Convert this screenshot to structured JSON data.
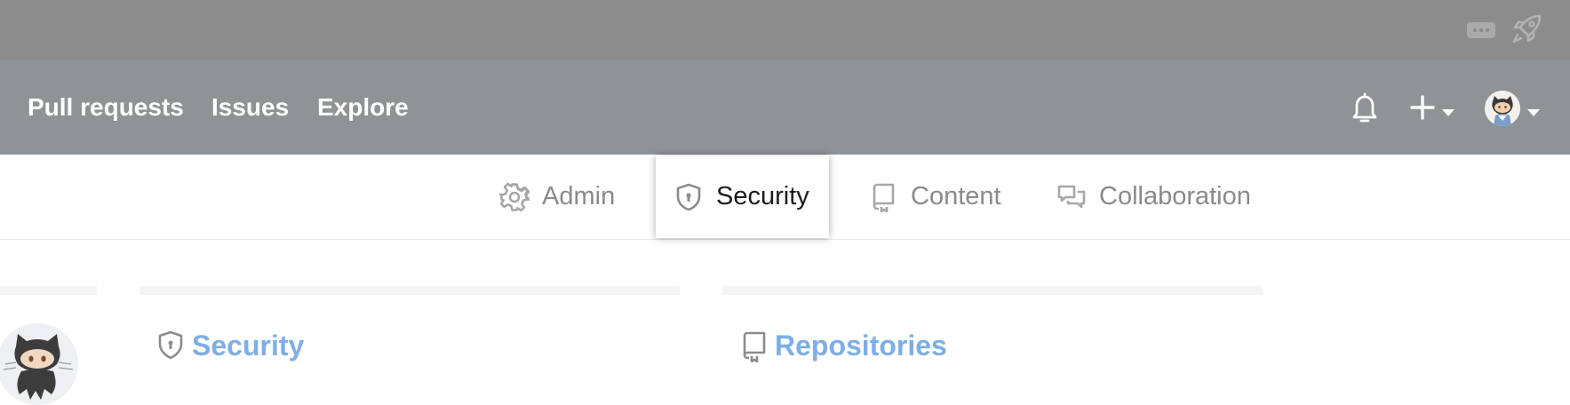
{
  "titlebar": {
    "icons": [
      "more-icon",
      "rocket-icon"
    ]
  },
  "topnav": {
    "links": [
      {
        "label": "Pull requests"
      },
      {
        "label": "Issues"
      },
      {
        "label": "Explore"
      }
    ],
    "icons": [
      "bell-icon",
      "plus-icon",
      "caret-down-icon",
      "avatar",
      "caret-down-icon"
    ]
  },
  "tabs": [
    {
      "label": "Admin",
      "icon": "gear-icon",
      "active": false
    },
    {
      "label": "Security",
      "icon": "shield-icon",
      "active": true
    },
    {
      "label": "Content",
      "icon": "repo-icon",
      "active": false
    },
    {
      "label": "Collaboration",
      "icon": "comment-discussion-icon",
      "active": false
    }
  ],
  "sections": [
    {
      "title": "Security",
      "icon": "shield-icon"
    },
    {
      "title": "Repositories",
      "icon": "repo-icon"
    }
  ],
  "colors": {
    "titlebar": "#8b8c8b",
    "topnav": "#909396",
    "link_accent": "#7eaee6",
    "tab_text": "#8a8a8a",
    "tab_active_text": "#1b1b1b"
  }
}
